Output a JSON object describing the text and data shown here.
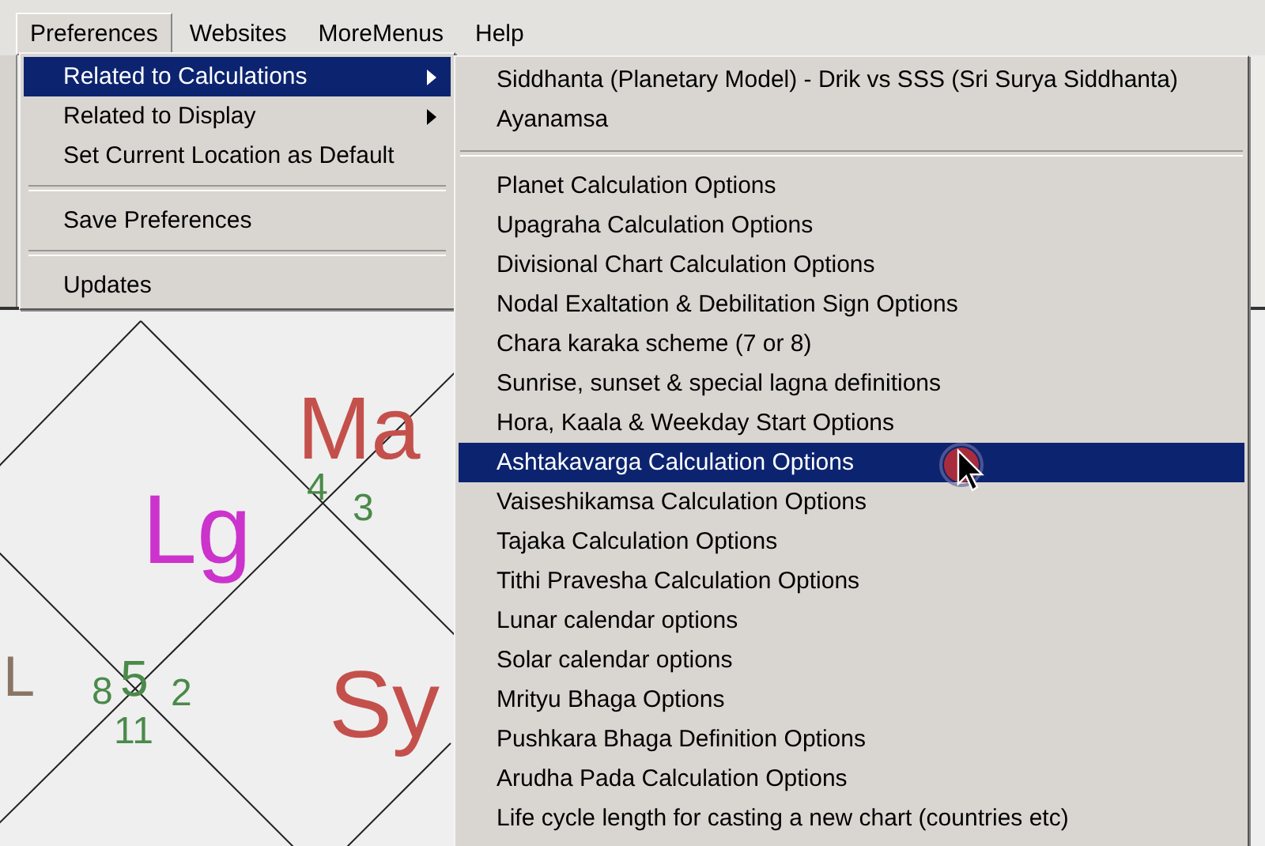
{
  "menubar": [
    {
      "label": "Preferences",
      "selected": true
    },
    {
      "label": "Websites",
      "selected": false
    },
    {
      "label": "MoreMenus",
      "selected": false
    },
    {
      "label": "Help",
      "selected": false
    }
  ],
  "menu": {
    "items": [
      {
        "kind": "item",
        "label": "Related to Calculations",
        "submenu": true,
        "selected": true
      },
      {
        "kind": "item",
        "label": "Related to Display",
        "submenu": true,
        "selected": false
      },
      {
        "kind": "item",
        "label": "Set Current Location as Default",
        "submenu": false,
        "selected": false
      },
      {
        "kind": "separator"
      },
      {
        "kind": "item",
        "label": "Save Preferences",
        "submenu": false,
        "selected": false
      },
      {
        "kind": "separator"
      },
      {
        "kind": "item",
        "label": "Updates",
        "submenu": false,
        "selected": false
      }
    ]
  },
  "submenu": {
    "items": [
      {
        "kind": "item",
        "label": "Siddhanta (Planetary Model) - Drik vs SSS (Sri Surya Siddhanta)",
        "selected": false
      },
      {
        "kind": "item",
        "label": "Ayanamsa",
        "selected": false
      },
      {
        "kind": "separator"
      },
      {
        "kind": "item",
        "label": "Planet Calculation Options",
        "selected": false
      },
      {
        "kind": "item",
        "label": "Upagraha Calculation Options",
        "selected": false
      },
      {
        "kind": "item",
        "label": "Divisional Chart Calculation Options",
        "selected": false
      },
      {
        "kind": "item",
        "label": "Nodal Exaltation & Debilitation Sign Options",
        "selected": false
      },
      {
        "kind": "item",
        "label": "Chara karaka scheme (7 or 8)",
        "selected": false
      },
      {
        "kind": "item",
        "label": "Sunrise, sunset & special lagna definitions",
        "selected": false
      },
      {
        "kind": "item",
        "label": "Hora, Kaala & Weekday Start Options",
        "selected": false
      },
      {
        "kind": "item",
        "label": "Ashtakavarga Calculation Options",
        "selected": true
      },
      {
        "kind": "item",
        "label": "Vaiseshikamsa Calculation Options",
        "selected": false
      },
      {
        "kind": "item",
        "label": "Tajaka Calculation Options",
        "selected": false
      },
      {
        "kind": "item",
        "label": "Tithi Pravesha Calculation Options",
        "selected": false
      },
      {
        "kind": "item",
        "label": "Lunar calendar options",
        "selected": false
      },
      {
        "kind": "item",
        "label": "Solar calendar options",
        "selected": false
      },
      {
        "kind": "item",
        "label": "Mrityu Bhaga Options",
        "selected": false
      },
      {
        "kind": "item",
        "label": "Pushkara Bhaga Definition Options",
        "selected": false
      },
      {
        "kind": "item",
        "label": "Arudha Pada Calculation Options",
        "selected": false
      },
      {
        "kind": "item",
        "label": "Life cycle length for casting a new chart (countries etc)",
        "selected": false
      }
    ]
  },
  "chart": {
    "labels": [
      {
        "text": "Ma",
        "color": "#c4504c"
      },
      {
        "text": "Lg",
        "color": "#cc33cc"
      },
      {
        "text": "4",
        "color": "#4a8a4a"
      },
      {
        "text": "3",
        "color": "#4a8a4a"
      },
      {
        "text": "L",
        "color": "#8a7565"
      },
      {
        "text": "8",
        "color": "#4a8a4a"
      },
      {
        "text": "5",
        "color": "#4a8a4a"
      },
      {
        "text": "2",
        "color": "#4a8a4a"
      },
      {
        "text": "11",
        "color": "#4a8a4a"
      },
      {
        "text": "Sy",
        "color": "#c4504c"
      }
    ]
  }
}
